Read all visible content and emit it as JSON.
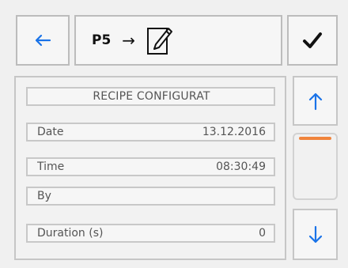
{
  "header": {
    "title": "P5",
    "title_arrow": "→"
  },
  "icons": {
    "back": "arrow-left-icon",
    "edit": "edit-document-icon",
    "confirm": "checkmark-icon",
    "up": "arrow-up-icon",
    "down": "arrow-down-icon"
  },
  "colors": {
    "accent_blue": "#1a73e8",
    "scroll_thumb": "#f0843c"
  },
  "section": {
    "header": "RECIPE CONFIGURAT",
    "fields": [
      {
        "label": "Date",
        "value": "13.12.2016"
      },
      {
        "label": "Time",
        "value": "08:30:49"
      },
      {
        "label": "By",
        "value": ""
      },
      {
        "label": "Duration (s)",
        "value": "0"
      }
    ]
  }
}
